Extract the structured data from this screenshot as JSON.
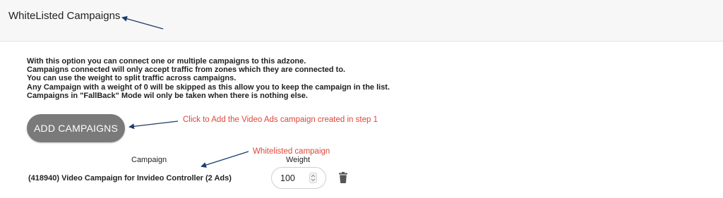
{
  "header": {
    "title": "WhiteListed Campaigns"
  },
  "description": {
    "lines": [
      "With this option you can connect one or multiple campaigns to this adzone.",
      "Campaigns connected will only accept traffic from zones which they are connected to.",
      "You can use the weight to split traffic across campaigns.",
      "Any Campaign with a weight of 0 will be skipped as this allow you to keep the campaign in the list.",
      "Campaigns in \"FallBack\" Mode wil only be taken when there is nothing else."
    ]
  },
  "add_button": {
    "label": "ADD CAMPAIGNS"
  },
  "annotations": {
    "add_hint": "Click to Add the Video Ads campaign created in step 1",
    "whitelisted_hint": "Whitelisted campaign",
    "color": "#e0453a",
    "arrow_color": "#1f3a6b"
  },
  "table": {
    "headers": {
      "campaign": "Campaign",
      "weight": "Weight"
    },
    "rows": [
      {
        "campaign": "(418940) Video Campaign for Invideo Controller (2 Ads)",
        "weight": "100"
      }
    ]
  },
  "icons": {
    "delete": "trash-icon",
    "stepper": "spinner-arrows-icon"
  }
}
